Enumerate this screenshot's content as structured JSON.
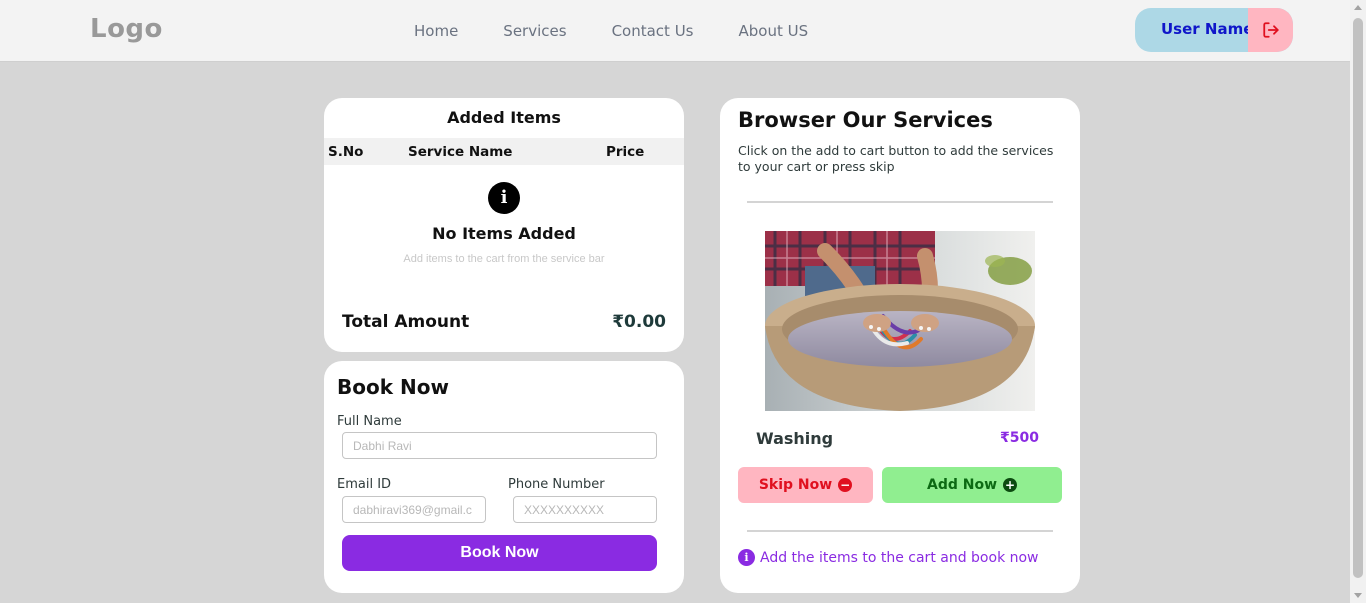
{
  "navbar": {
    "logo": "Logo",
    "links": [
      "Home",
      "Services",
      "Contact Us",
      "About US"
    ],
    "user_name": "User Name",
    "logout_icon": "logout-icon"
  },
  "added_items": {
    "title": "Added Items",
    "columns": [
      "S.No",
      "Service Name",
      "Price"
    ],
    "empty_icon": "info-icon",
    "empty_title": "No Items Added",
    "empty_subtitle": "Add items to the cart from the service bar",
    "total_label": "Total Amount",
    "total_value": "₹0.00"
  },
  "book_now": {
    "title": "Book Now",
    "full_name_label": "Full Name",
    "full_name_placeholder": "Dabhi Ravi",
    "email_label": "Email ID",
    "email_placeholder": "dabhiravi369@gmail.c",
    "phone_label": "Phone Number",
    "phone_placeholder": "XXXXXXXXXX",
    "submit_label": "Book Now",
    "accent_color": "#8a2be2"
  },
  "services": {
    "title": "Browser Our Services",
    "description": "Click on the add to cart button to add the services to your cart or press skip",
    "current_service": {
      "name": "Washing",
      "price": "₹500",
      "image": "hands-washing-clothes-in-basin"
    },
    "skip_label": "Skip Now",
    "add_label": "Add Now",
    "footer_note": "Add the items to the cart and book now"
  }
}
